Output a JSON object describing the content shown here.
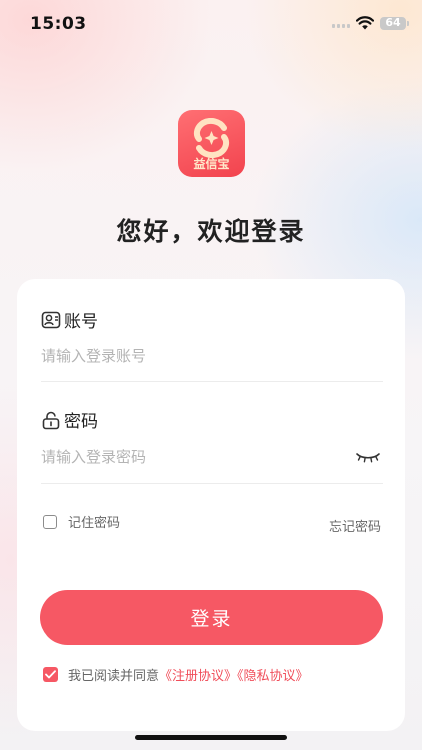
{
  "status_bar": {
    "time": "15:03",
    "battery": "64"
  },
  "app": {
    "logo_text": "益信宝",
    "brand_color": "#f65864"
  },
  "welcome": "您好，欢迎登录",
  "form": {
    "account_label": "账号",
    "account_placeholder": "请输入登录账号",
    "password_label": "密码",
    "password_placeholder": "请输入登录密码",
    "remember_label": "记住密码",
    "remember_checked": false,
    "forgot_label": "忘记密码",
    "login_label": "登录"
  },
  "agreement": {
    "checked": true,
    "text": "我已阅读并同意",
    "register_link": "《注册协议》",
    "privacy_link": "《隐私协议》"
  },
  "icons": [
    "signal-icon",
    "wifi-icon",
    "battery-icon",
    "app-logo-icon",
    "user-icon",
    "lock-icon",
    "eye-closed-icon",
    "checkbox-icon",
    "checkmark-icon"
  ]
}
